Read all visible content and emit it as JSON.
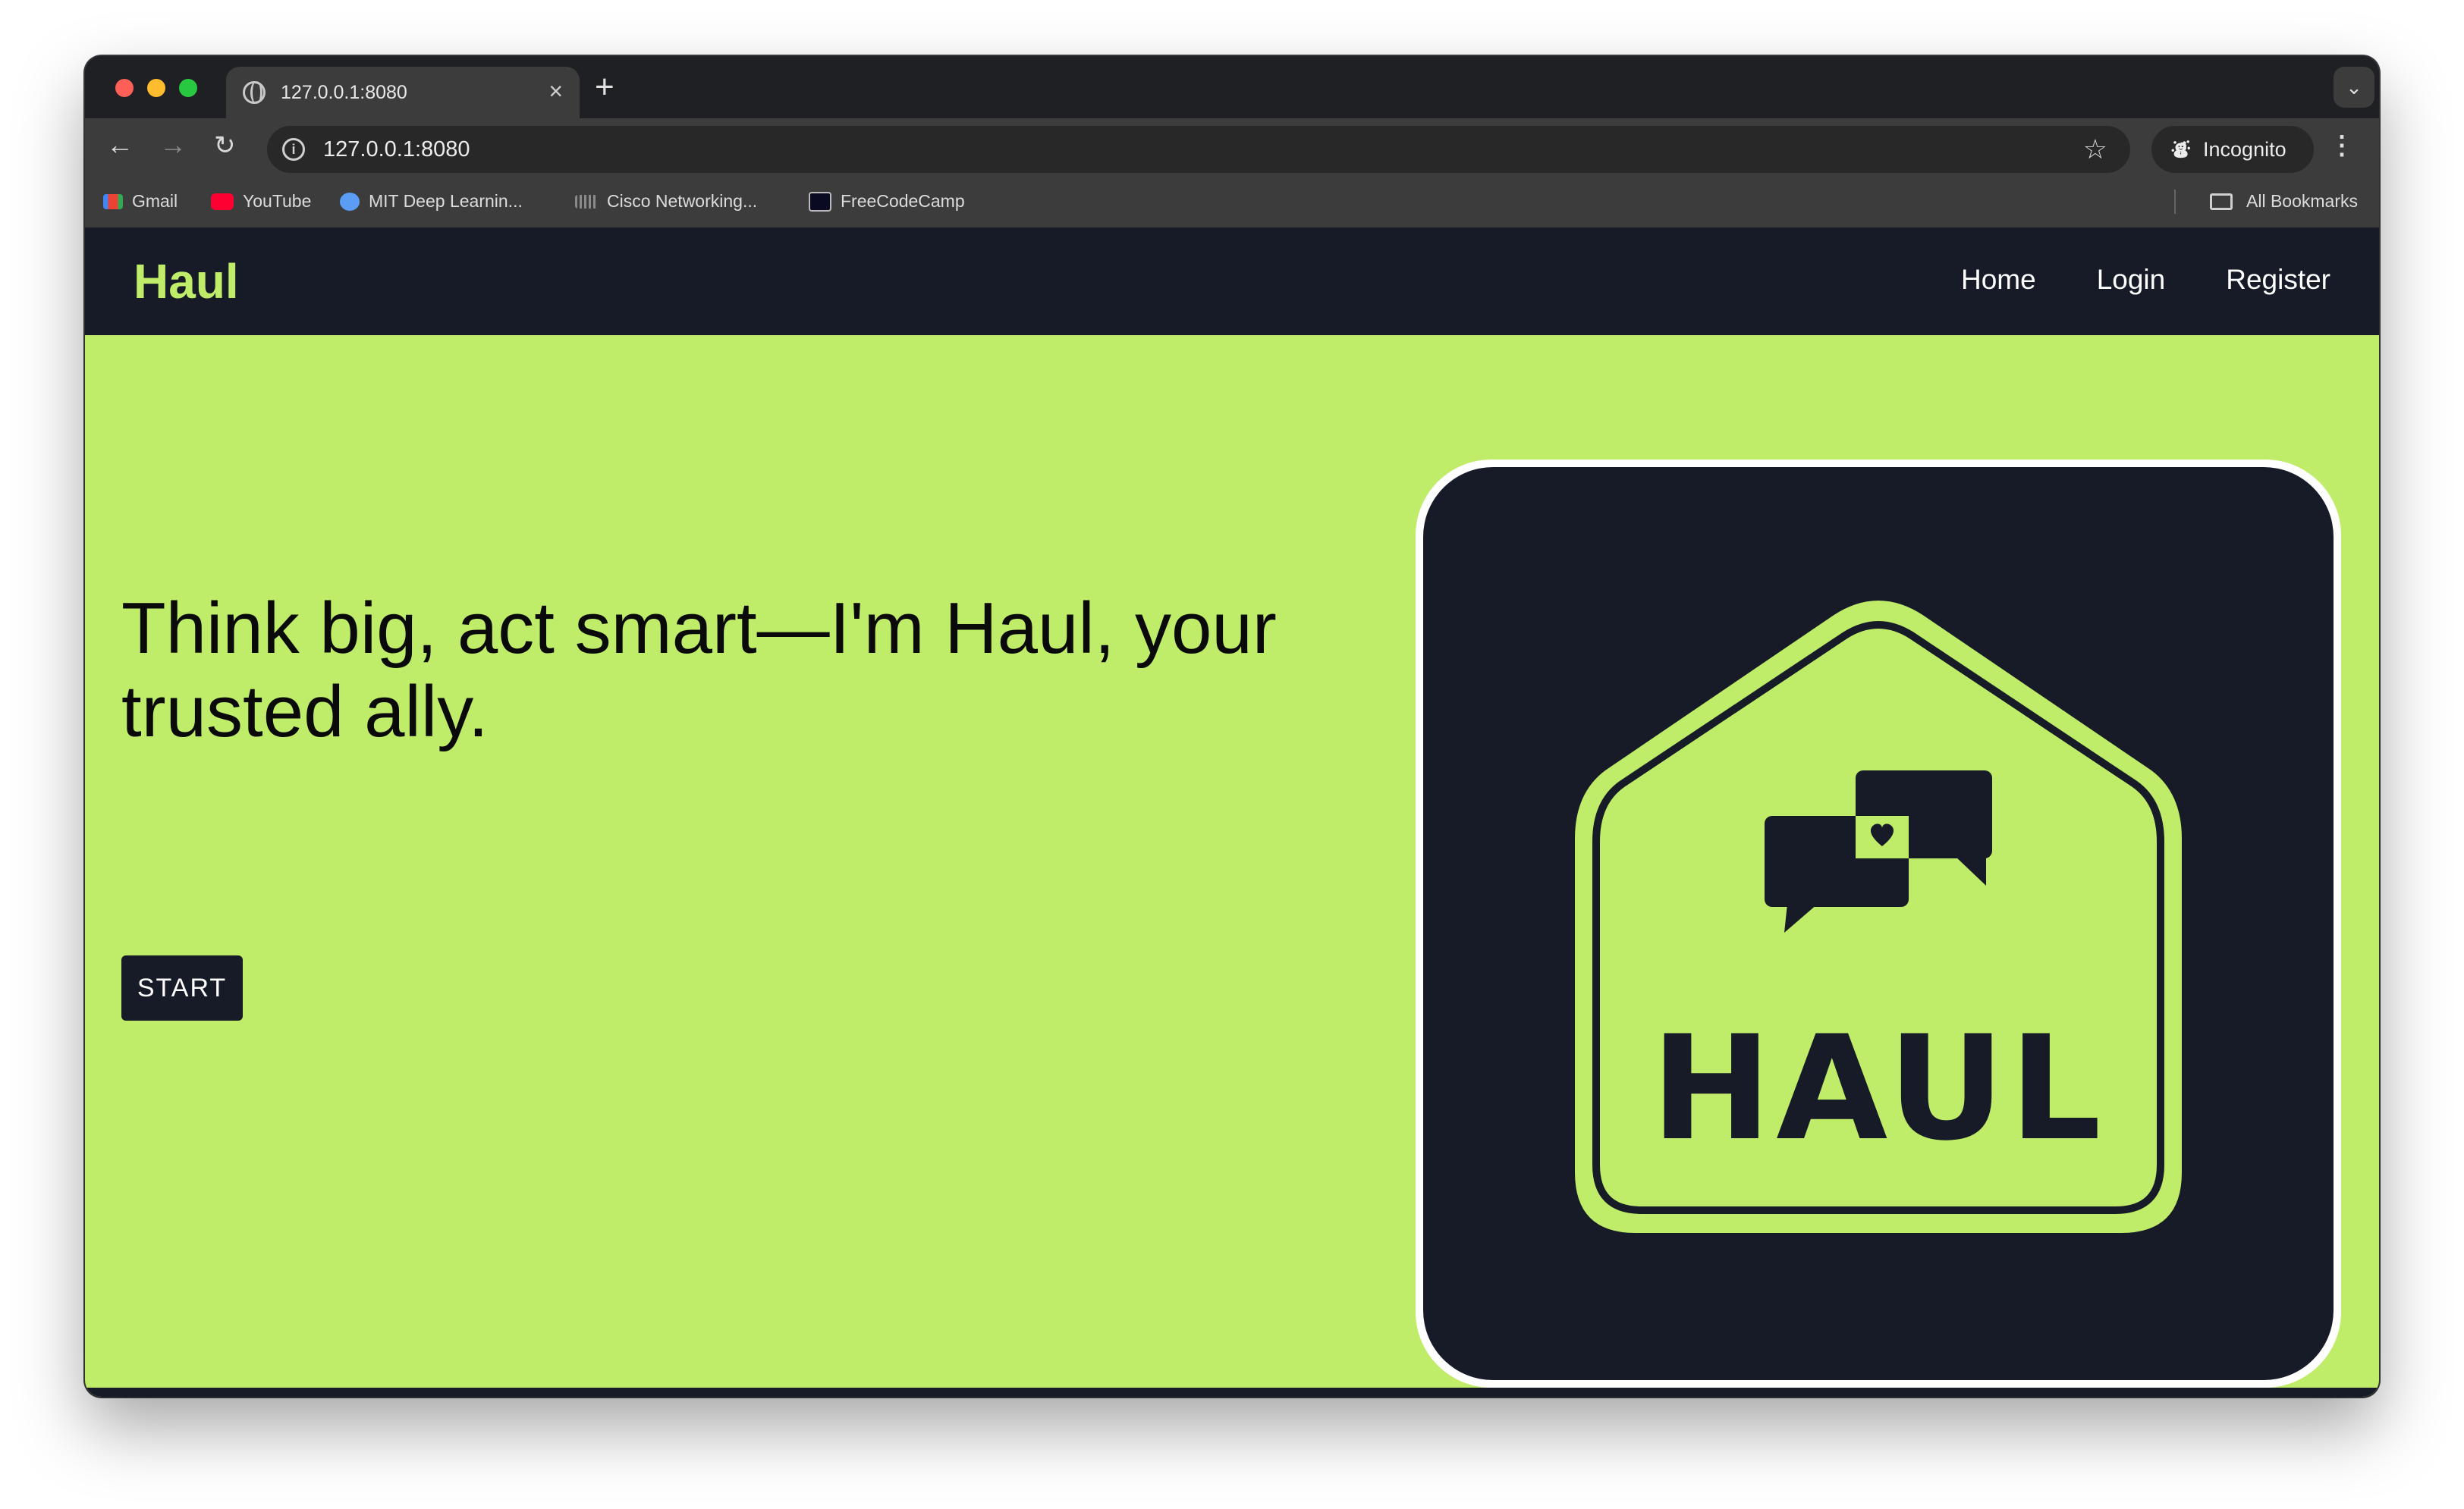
{
  "browser": {
    "tab_title": "127.0.0.1:8080",
    "url": "127.0.0.1:8080",
    "incognito_label": "Incognito",
    "bookmarks": [
      {
        "label": "Gmail",
        "icon": "gmail-icon"
      },
      {
        "label": "YouTube",
        "icon": "youtube-icon"
      },
      {
        "label": "MIT Deep Learnin...",
        "icon": "mit-icon"
      },
      {
        "label": "Cisco Networking...",
        "icon": "cisco-icon"
      },
      {
        "label": "FreeCodeCamp",
        "icon": "freecodecamp-icon"
      }
    ],
    "all_bookmarks_label": "All Bookmarks"
  },
  "site": {
    "brand": "Haul",
    "nav": {
      "home": "Home",
      "login": "Login",
      "register": "Register"
    },
    "hero_text": "Think big, act smart—I'm Haul, your trusted ally.",
    "start_label": "START",
    "logo_text": "HAUL"
  },
  "colors": {
    "accent": "#c0ed69",
    "dark": "#171b27"
  }
}
